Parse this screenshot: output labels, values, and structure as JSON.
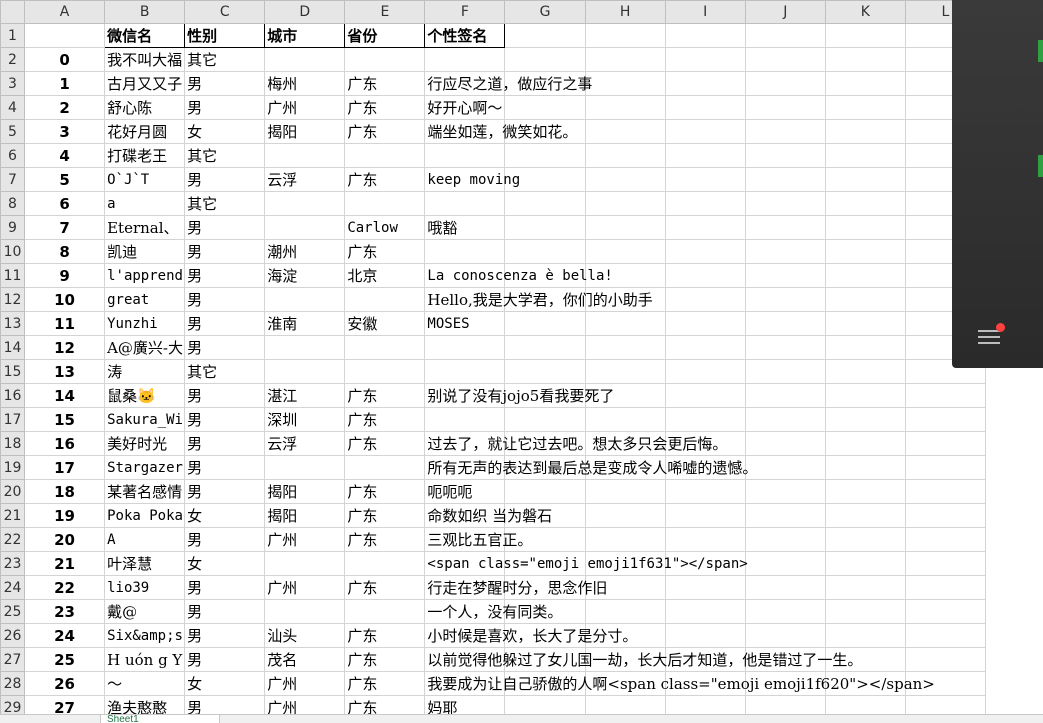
{
  "columns": [
    "A",
    "B",
    "C",
    "D",
    "E",
    "F",
    "G",
    "H",
    "I",
    "J",
    "K",
    "L"
  ],
  "header_row": {
    "num": "1",
    "cells": [
      "",
      "微信名",
      "性别",
      "城市",
      "省份",
      "个性签名"
    ]
  },
  "rows": [
    {
      "num": "2",
      "idx": "0",
      "name": "我不叫大福",
      "sex": "其它",
      "city": "",
      "prov": "",
      "sig": ""
    },
    {
      "num": "3",
      "idx": "1",
      "name": "古月又又子",
      "sex": "男",
      "city": "梅州",
      "prov": "广东",
      "sig": "行应尽之道，做应行之事"
    },
    {
      "num": "4",
      "idx": "2",
      "name": "舒心陈",
      "sex": "男",
      "city": "广州",
      "prov": "广东",
      "sig": "好开心啊～"
    },
    {
      "num": "5",
      "idx": "3",
      "name": "花好月圆",
      "sex": "女",
      "city": "揭阳",
      "prov": "广东",
      "sig": "端坐如莲，微笑如花。"
    },
    {
      "num": "6",
      "idx": "4",
      "name": "打碟老王",
      "sex": "其它",
      "city": "",
      "prov": "",
      "sig": ""
    },
    {
      "num": "7",
      "idx": "5",
      "name": "O`J`T",
      "sex": "男",
      "city": "云浮",
      "prov": "广东",
      "sig": "keep  moving"
    },
    {
      "num": "8",
      "idx": "6",
      "name": "a",
      "sex": "其它",
      "city": "",
      "prov": "",
      "sig": ""
    },
    {
      "num": "9",
      "idx": "7",
      "name": "Eternal、",
      "sex": "男",
      "city": "",
      "prov": "Carlow",
      "sig": "哦豁"
    },
    {
      "num": "10",
      "idx": "8",
      "name": "凯迪",
      "sex": "男",
      "city": "潮州",
      "prov": "广东",
      "sig": ""
    },
    {
      "num": "11",
      "idx": "9",
      "name": "l'apprendre",
      "sex": "男",
      "city": "海淀",
      "prov": "北京",
      "sig": "La conoscenza è bella!"
    },
    {
      "num": "12",
      "idx": "10",
      "name": "great",
      "sex": "男",
      "city": "",
      "prov": "",
      "sig": "Hello,我是大学君，你们的小助手"
    },
    {
      "num": "13",
      "idx": "11",
      "name": "Yunzhi",
      "sex": "男",
      "city": "淮南",
      "prov": "安徽",
      "sig": "MOSES"
    },
    {
      "num": "14",
      "idx": "12",
      "name": "A@廣兴-大",
      "sex": "男",
      "city": "",
      "prov": "",
      "sig": ""
    },
    {
      "num": "15",
      "idx": "13",
      "name": "涛",
      "sex": "其它",
      "city": "",
      "prov": "",
      "sig": ""
    },
    {
      "num": "16",
      "idx": "14",
      "name": "鼠桑🐱",
      "sex": "男",
      "city": "湛江",
      "prov": "广东",
      "sig": "别说了没有jojo5看我要死了"
    },
    {
      "num": "17",
      "idx": "15",
      "name": "Sakura_Wi",
      "sex": "男",
      "city": "深圳",
      "prov": "广东",
      "sig": ""
    },
    {
      "num": "18",
      "idx": "16",
      "name": "美好时光",
      "sex": "男",
      "city": "云浮",
      "prov": "广东",
      "sig": "过去了，就让它过去吧。想太多只会更后悔。"
    },
    {
      "num": "19",
      "idx": "17",
      "name": "Stargazer",
      "sex": "男",
      "city": "",
      "prov": "",
      "sig": "所有无声的表达到最后总是变成令人唏嘘的遗憾。"
    },
    {
      "num": "20",
      "idx": "18",
      "name": "某著名感情",
      "sex": "男",
      "city": "揭阳",
      "prov": "广东",
      "sig": "呃呃呃"
    },
    {
      "num": "21",
      "idx": "19",
      "name": "Poka Poka",
      "sex": "女",
      "city": "揭阳",
      "prov": "广东",
      "sig": "命数如织  当为磐石"
    },
    {
      "num": "22",
      "idx": "20",
      "name": "A",
      "sex": "男",
      "city": "广州",
      "prov": "广东",
      "sig": "三观比五官正。"
    },
    {
      "num": "23",
      "idx": "21",
      "name": "叶泽慧",
      "sex": "女",
      "city": "",
      "prov": "",
      "sig": "<span class=\"emoji emoji1f631\"></span>"
    },
    {
      "num": "24",
      "idx": "22",
      "name": "lio39",
      "sex": "男",
      "city": "广州",
      "prov": "广东",
      "sig": "行走在梦醒时分，思念作旧"
    },
    {
      "num": "25",
      "idx": "23",
      "name": "戴@",
      "sex": "男",
      "city": "",
      "prov": "",
      "sig": "一个人，没有同类。"
    },
    {
      "num": "26",
      "idx": "24",
      "name": "Six&amp;s",
      "sex": "男",
      "city": "汕头",
      "prov": "广东",
      "sig": "小时候是喜欢，长大了是分寸。"
    },
    {
      "num": "27",
      "idx": "25",
      "name": "H uón g Y",
      "sex": "男",
      "city": "茂名",
      "prov": "广东",
      "sig": "以前觉得他躲过了女儿国一劫，长大后才知道，他是错过了一生。"
    },
    {
      "num": "28",
      "idx": "26",
      "name": "～",
      "sex": "女",
      "city": "广州",
      "prov": "广东",
      "sig": "我要成为让自己骄傲的人啊<span class=\"emoji emoji1f620\"></span>"
    },
    {
      "num": "29",
      "idx": "27",
      "name": "渔夫憨憨",
      "sex": "男",
      "city": "广州",
      "prov": "广东",
      "sig": "妈耶"
    }
  ],
  "sheet_tab": "Sheet1",
  "overlay": {
    "menu_icon": "hamburger-menu-icon",
    "badge_color": "#ff4040"
  }
}
